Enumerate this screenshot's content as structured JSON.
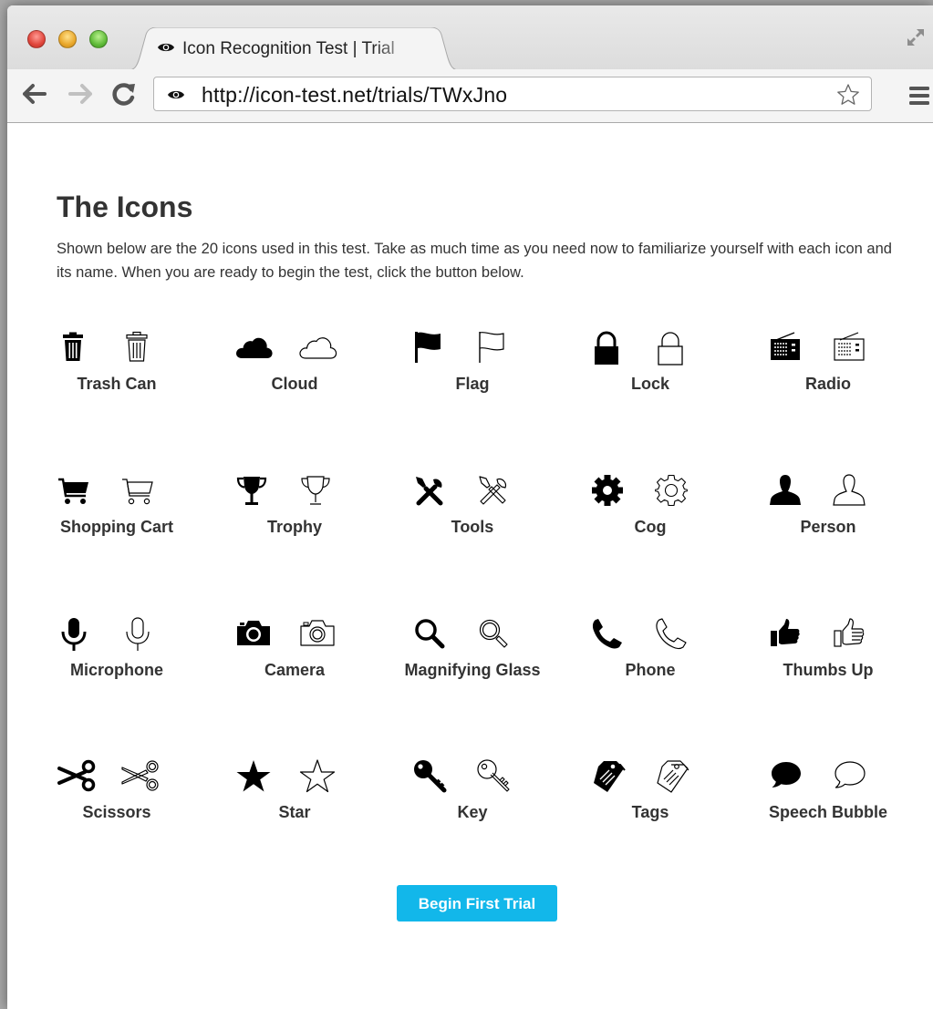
{
  "browser": {
    "tab_title": "Icon Recognition Test | Trial",
    "url": "http://icon-test.net/trials/TWxJno"
  },
  "page": {
    "heading": "The Icons",
    "intro": "Shown below are the 20 icons used in this test. Take as much time as you need now to familiarize yourself with each icon and its name. When you are ready to begin the test, click the button below.",
    "icons": [
      {
        "name": "Trash Can",
        "icon": "trash-can-icon"
      },
      {
        "name": "Cloud",
        "icon": "cloud-icon"
      },
      {
        "name": "Flag",
        "icon": "flag-icon"
      },
      {
        "name": "Lock",
        "icon": "lock-icon"
      },
      {
        "name": "Radio",
        "icon": "radio-icon"
      },
      {
        "name": "Shopping Cart",
        "icon": "shopping-cart-icon"
      },
      {
        "name": "Trophy",
        "icon": "trophy-icon"
      },
      {
        "name": "Tools",
        "icon": "tools-icon"
      },
      {
        "name": "Cog",
        "icon": "cog-icon"
      },
      {
        "name": "Person",
        "icon": "person-icon"
      },
      {
        "name": "Microphone",
        "icon": "microphone-icon"
      },
      {
        "name": "Camera",
        "icon": "camera-icon"
      },
      {
        "name": "Magnifying Glass",
        "icon": "magnifying-glass-icon"
      },
      {
        "name": "Phone",
        "icon": "phone-icon"
      },
      {
        "name": "Thumbs Up",
        "icon": "thumbs-up-icon"
      },
      {
        "name": "Scissors",
        "icon": "scissors-icon"
      },
      {
        "name": "Star",
        "icon": "star-icon"
      },
      {
        "name": "Key",
        "icon": "key-icon"
      },
      {
        "name": "Tags",
        "icon": "tags-icon"
      },
      {
        "name": "Speech Bubble",
        "icon": "speech-bubble-icon"
      }
    ],
    "button_label": "Begin First Trial",
    "accent_color": "#12b7ea"
  }
}
